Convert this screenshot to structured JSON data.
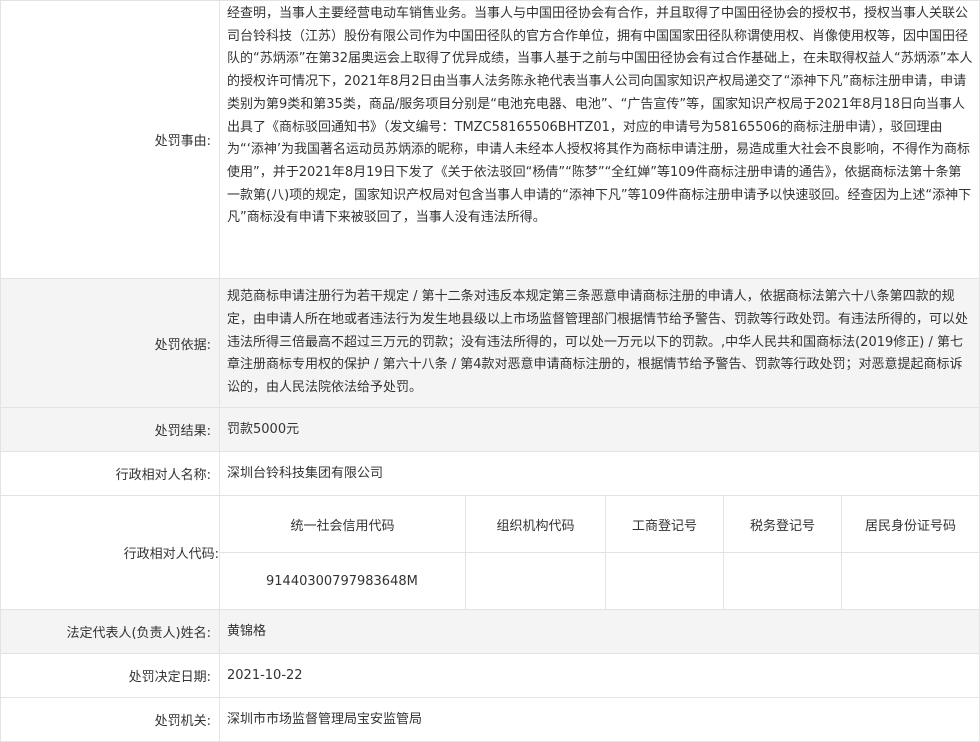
{
  "rows": {
    "matter": {
      "label": "处罚事由:",
      "text": "经查明，当事人主要经营电动车销售业务。当事人与中国田径协会有合作，并且取得了中国田径协会的授权书，授权当事人关联公司台铃科技（江苏）股份有限公司作为中国田径队的官方合作单位，拥有中国国家田径队称谓使用权、肖像使用权等，因中国田径队的“苏炳添”在第32届奥运会上取得了优异成绩，当事人基于之前与中国田径协会有过合作基础上，在未取得权益人“苏炳添”本人的授权许可情况下，2021年8月2日由当事人法务陈永艳代表当事人公司向国家知识产权局递交了“添神下凡”商标注册申请，申请类别为第9类和第35类，商品/服务项目分别是“电池充电器、电池”、“广告宣传”等，国家知识产权局于2021年8月18日向当事人出具了《商标驳回通知书》（发文编号：TMZC58165506BHTZ01，对应的申请号为58165506的商标注册申请），驳回理由为“‘添神’为我国著名运动员苏炳添的昵称，申请人未经本人授权将其作为商标申请注册，易造成重大社会不良影响，不得作为商标使用”，并于2021年8月19日下发了《关于依法驳回“杨倩”“陈梦”“全红婵”等109件商标注册申请的通告》，依据商标法第十条第一款第(八)项的规定，国家知识产权局对包含当事人申请的“添神下凡”等109件商标注册申请予以快速驳回。经查因为上述“添神下凡”商标没有申请下来被驳回了，当事人没有违法所得。"
    },
    "basis": {
      "label": "处罚依据:",
      "text": "规范商标申请注册行为若干规定 / 第十二条对违反本规定第三条恶意申请商标注册的申请人，依据商标法第六十八条第四款的规定，由申请人所在地或者违法行为发生地县级以上市场监督管理部门根据情节给予警告、罚款等行政处罚。有违法所得的，可以处违法所得三倍最高不超过三万元的罚款；没有违法所得的，可以处一万元以下的罚款。,中华人民共和国商标法(2019修正) / 第七章注册商标专用权的保护 / 第六十八条 / 第4款对恶意申请商标注册的，根据情节给予警告、罚款等行政处罚；对恶意提起商标诉讼的，由人民法院依法给予处罚。"
    },
    "result": {
      "label": "处罚结果:",
      "value": "罚款5000元"
    },
    "party_name": {
      "label": "行政相对人名称:",
      "value": "深圳台铃科技集团有限公司"
    },
    "party_codes": {
      "label": "行政相对人代码:",
      "headers": [
        "统一社会信用代码",
        "组织机构代码",
        "工商登记号",
        "税务登记号",
        "居民身份证号码"
      ],
      "values": [
        "91440300797983648M",
        "",
        "",
        "",
        ""
      ]
    },
    "legal_rep": {
      "label": "法定代表人(负责人)姓名:",
      "value": "黄锦格"
    },
    "decision_date": {
      "label": "处罚决定日期:",
      "value": "2021-10-22"
    },
    "authority": {
      "label": "处罚机关:",
      "value": "深圳市市场监督管理局宝安监管局"
    }
  }
}
